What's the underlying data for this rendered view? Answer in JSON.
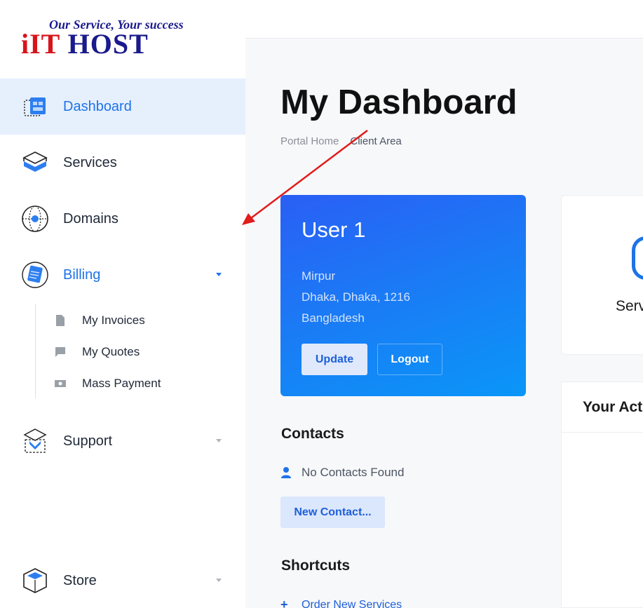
{
  "logo": {
    "tagline": "Our Service, Your success",
    "brand_red": "iIT",
    "brand_blue": " HOST"
  },
  "sidebar": {
    "items": [
      {
        "label": "Dashboard",
        "icon": "dashboard-icon",
        "active": true
      },
      {
        "label": "Services",
        "icon": "services-icon"
      },
      {
        "label": "Domains",
        "icon": "globe-icon"
      },
      {
        "label": "Billing",
        "icon": "billing-icon",
        "expanded": true
      },
      {
        "label": "Support",
        "icon": "support-icon"
      },
      {
        "label": "Store",
        "icon": "store-icon"
      }
    ],
    "billing_sub": [
      {
        "label": "My Invoices",
        "icon": "document-icon"
      },
      {
        "label": "My Quotes",
        "icon": "comment-icon"
      },
      {
        "label": "Mass Payment",
        "icon": "money-icon"
      }
    ]
  },
  "page": {
    "title": "My Dashboard",
    "breadcrumb": {
      "home": "Portal Home",
      "current": "Client Area"
    }
  },
  "user_card": {
    "name": "User 1",
    "address_line1": "Mirpur",
    "address_line2": "Dhaka, Dhaka, 1216",
    "address_line3": "Bangladesh",
    "update_label": "Update",
    "logout_label": "Logout"
  },
  "contacts": {
    "title": "Contacts",
    "empty_text": "No Contacts Found",
    "new_button": "New Contact..."
  },
  "shortcuts": {
    "title": "Shortcuts",
    "order_link": "Order New Services"
  },
  "stats_card": {
    "label": "Serv"
  },
  "activity_card": {
    "title": "Your Act"
  },
  "colors": {
    "accent": "#1e73e8",
    "active_bg": "#e6f0fd",
    "arrow": "#e21b1b"
  }
}
